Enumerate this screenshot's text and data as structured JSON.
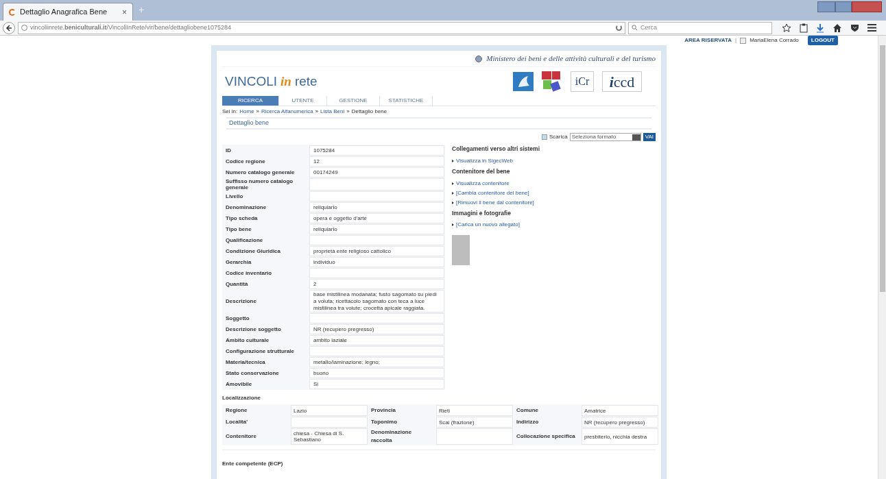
{
  "browser": {
    "tab_title": "Dettaglio Anagrafica Bene",
    "tab_close": "×",
    "new_tab": "+",
    "url": "vincoliinrete.**beniculturali.it**/VincoliInRete/vir/bene/dettagliobene1075284",
    "search": {
      "placeholder": "Cerca"
    }
  },
  "user_bar": {
    "area": "AREA RISERVATA",
    "separator": "|",
    "user": "MariaElena Corrado",
    "logout": "LOGOUT"
  },
  "header": {
    "ministry": "Ministero dei beni e delle attività culturali e del turismo",
    "title_main": "VINCOLI",
    "title_in": "in",
    "title_rete": "rete",
    "logo_icr": "iCr",
    "logo_iccd_i": "i",
    "logo_iccd": "ccd"
  },
  "tabs": [
    {
      "label": "RICERCA",
      "selected": true
    },
    {
      "label": "UTENTE",
      "selected": false
    },
    {
      "label": "GESTIONE",
      "selected": false
    },
    {
      "label": "STATISTICHE",
      "selected": false
    }
  ],
  "breadcrumb": {
    "prefix": "Sei in:",
    "items": [
      "Home",
      "Ricerca Alfanumerica",
      "Lista Beni"
    ],
    "separator": "»",
    "current": "Dettaglio bene"
  },
  "page_title": "Dettaglio bene",
  "download": {
    "label": "Scarica",
    "select": "Seleziona formato",
    "button": "VAI"
  },
  "fields": [
    {
      "label": "ID",
      "value": "1075284"
    },
    {
      "label": "Codice regione",
      "value": "12"
    },
    {
      "label": "Numero catalogo generale",
      "value": "00174249"
    },
    {
      "label": "Suffisso numero catalogo generale"
    },
    {
      "label": "Livello"
    },
    {
      "label": "Denominazione",
      "value": "reliquiario"
    },
    {
      "label": "Tipo scheda",
      "value": "opera e oggetto d'arte"
    },
    {
      "label": "Tipo bene",
      "value": "reliquiario"
    },
    {
      "label": "Qualificazione"
    },
    {
      "label": "Condizione Giuridica",
      "value": "proprietà ente religioso cattolico"
    },
    {
      "label": "Gerarchia",
      "value": "individuo"
    },
    {
      "label": "Codice inventario"
    },
    {
      "label": "Quantità",
      "value": "2"
    },
    {
      "label": "Descrizione",
      "value": "base mistilinea modanata; fusto sagomato su piedi a voluta; ricettacolo sagomato con teca a luce mistilinea tra volute; crocetta apicale raggiata."
    },
    {
      "label": "Soggetto"
    },
    {
      "label": "Descrizione soggetto",
      "value": "NR (recupero pregresso)"
    },
    {
      "label": "Ambito culturale",
      "value": "ambito laziale"
    },
    {
      "label": "Configurazione strutturale"
    },
    {
      "label": "Materia/tecnica",
      "value": "metallo/laminazione; legno;"
    },
    {
      "label": "Stato conservazione",
      "value": "buono"
    },
    {
      "label": "Amovibile",
      "value": "Si"
    }
  ],
  "side_sections": [
    {
      "title": "Collegamenti verso altri sistemi",
      "links": [
        "Visualizza in SigecWeb"
      ]
    },
    {
      "title": "Contenitore del bene",
      "links": [
        "Visualizza contenitore",
        "[Cambia contenitore del bene]",
        "[Rimuovi il bene dal contenitore]"
      ]
    },
    {
      "title": "Immagini e fotografie",
      "links": [
        "[Carica un nuovo allegato]"
      ]
    }
  ],
  "localizzazione": {
    "title": "Localizzazione",
    "rows": [
      [
        {
          "label": "Regione",
          "value": "Lazio"
        },
        {
          "label": "Provincia",
          "value": "Rieti"
        },
        {
          "label": "Comune",
          "value": "Amatrice"
        }
      ],
      [
        {
          "label": "Localita'"
        },
        {
          "label": "Toponimo",
          "value": "Scai (frazione)"
        },
        {
          "label": "Indirizzo",
          "value": "NR (recupero pregresso)"
        }
      ],
      [
        {
          "label": "Contenitore",
          "value": "chiesa - Chiesa di S. Sebastiano"
        },
        {
          "label": "Denominazione raccolta"
        },
        {
          "label": "Collocazione specifica",
          "value": "presbiterio, nicchia destra"
        }
      ]
    ]
  },
  "ente_title": "Ente competente (ECP)"
}
